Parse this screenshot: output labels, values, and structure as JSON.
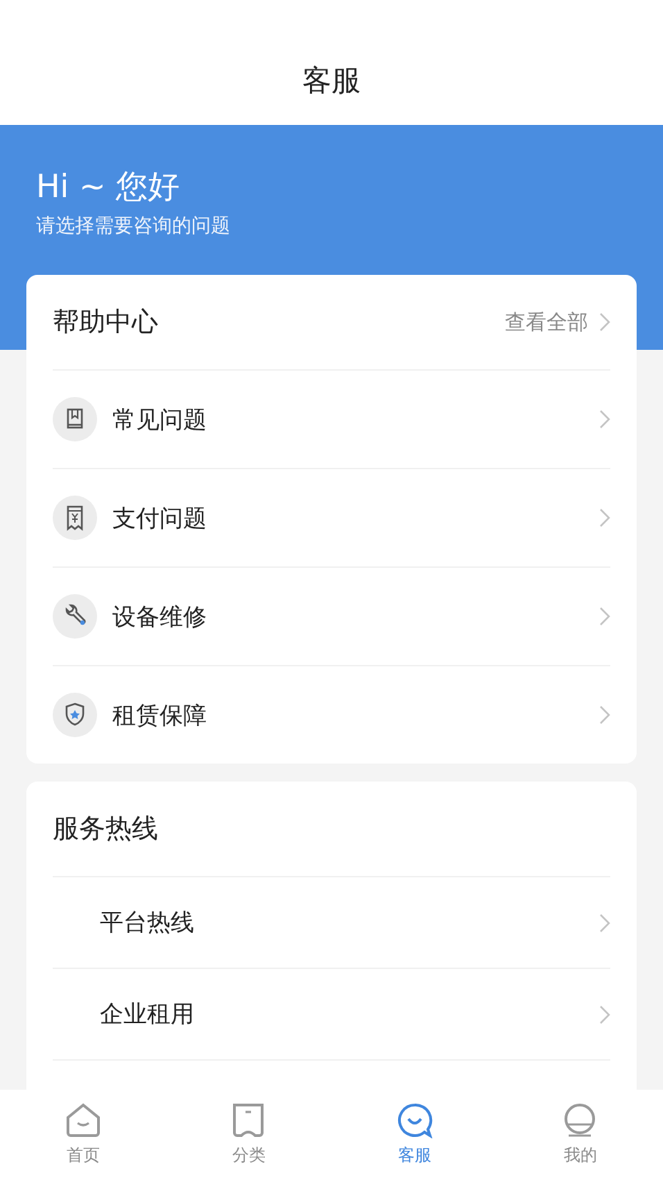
{
  "header": {
    "title": "客服"
  },
  "banner": {
    "greeting": "Hi ~ 您好",
    "subtitle": "请选择需要咨询的问题"
  },
  "help_center": {
    "title": "帮助中心",
    "view_all": "查看全部",
    "items": [
      {
        "label": "常见问题",
        "kind": "book"
      },
      {
        "label": "支付问题",
        "kind": "receipt"
      },
      {
        "label": "设备维修",
        "kind": "wrench"
      },
      {
        "label": "租赁保障",
        "kind": "shield"
      }
    ]
  },
  "hotline": {
    "title": "服务热线",
    "items": [
      {
        "label": "平台热线"
      },
      {
        "label": "企业租用"
      }
    ]
  },
  "tab_bar": [
    {
      "label": "首页",
      "kind": "home",
      "selected": false
    },
    {
      "label": "分类",
      "kind": "category",
      "selected": false
    },
    {
      "label": "客服",
      "kind": "service",
      "selected": true
    },
    {
      "label": "我的",
      "kind": "profile",
      "selected": false
    }
  ]
}
